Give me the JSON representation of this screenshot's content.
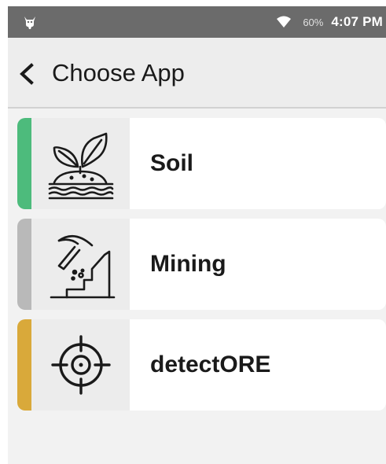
{
  "status_bar": {
    "app_icon": "android-icon",
    "wifi_icon": "wifi-icon",
    "battery": "60%",
    "time": "4:07 PM"
  },
  "header": {
    "back_icon": "chevron-left-icon",
    "title": "Choose App"
  },
  "apps": [
    {
      "label": "Soil",
      "icon": "plant-soil-icon",
      "accent": "#4dbb7c"
    },
    {
      "label": "Mining",
      "icon": "mining-pickaxe-icon",
      "accent": "#b9b9b9"
    },
    {
      "label": "detectORE",
      "icon": "crosshair-icon",
      "accent": "#d9a93a"
    }
  ],
  "colors": {
    "status_bar_bg": "#6b6b6b",
    "screen_bg": "#f2f2f2",
    "card_bg": "#ffffff",
    "icon_box_bg": "#ececec"
  }
}
